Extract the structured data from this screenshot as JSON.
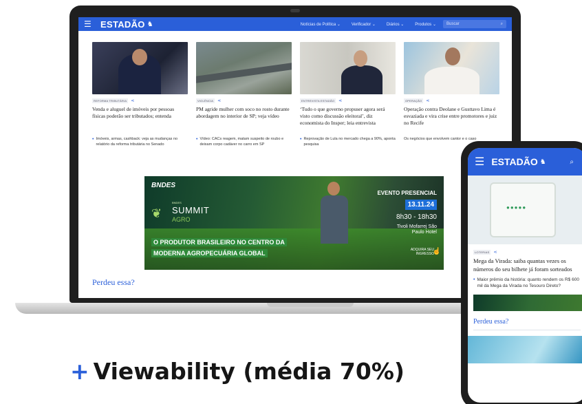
{
  "desktop": {
    "nav": {
      "logo": "ESTADÃO",
      "links": [
        "Notícias de Política ⌄",
        "Verificador ⌄",
        "Diários ⌄",
        "Produtos ⌄"
      ],
      "search_placeholder": "Buscar",
      "menu_icon": "hamburger-icon",
      "search_icon": "search-icon"
    },
    "articles": [
      {
        "tag": "REFORMA TRIBUTÁRIA",
        "title": "Venda e aluguel de imóveis por pessoas físicas poderão ser tributados; entenda",
        "related": "Imóveis, armas, cashback: veja as mudanças no relatório da reforma tributária no Senado"
      },
      {
        "tag": "VIOLÊNCIA",
        "title": "PM agride mulher com soco no rosto durante abordagem no interior de SP; veja vídeo",
        "related": "Vídeo: CACs reagem, matam suspeito de roubo e deixam corpo cadáver no carro em SP"
      },
      {
        "tag": "ENTREVISTA ESTADÃO",
        "title": "‘Tudo o que governo propuser agora será visto como discussão eleitoral’, diz economista do Insper; leia entrevista",
        "related": "Reprovação de Lula no mercado chega a 90%, aponta pesquisa"
      },
      {
        "tag": "OPERAÇÃO",
        "title": "Operação contra Deolane e Gusttavo Lima é esvaziada e vira crise entre promotores e juiz no Recife",
        "related": "Os negócios que envolvem cantor e o caso"
      }
    ],
    "banner": {
      "sponsor": "BNDES",
      "summit_small": "BNDES",
      "summit": "SUMMIT",
      "summit_sub": "AGRO",
      "event_label": "EVENTO PRESENCIAL",
      "date": "13.11.24",
      "time": "8h30 - 18h30",
      "venue": "Tivoli Mofarrej São Paulo Hotel",
      "headline": "O PRODUTOR BRASILEIRO NO CENTRO DA MODERNA AGROPECUÁRIA GLOBAL",
      "cta": "ADQUIRA SEU INGRESSO"
    },
    "missed": "Perdeu essa?"
  },
  "mobile": {
    "logo": "ESTADÃO",
    "tag": "LOTERIAS",
    "title": "Mega da Virada: saiba quantas vezes os números do seu bilhete já foram sorteados",
    "related": "Maior prêmio da história: quanto rendem os R$ 600 mil da Mega da Virada no Tesouro Direto?",
    "missed": "Perdeu essa?"
  },
  "caption": {
    "plus": "+",
    "text": "Viewability (média 70%)"
  },
  "colors": {
    "brand_blue": "#2a5fd9",
    "banner_green": "#2f8a3a"
  }
}
